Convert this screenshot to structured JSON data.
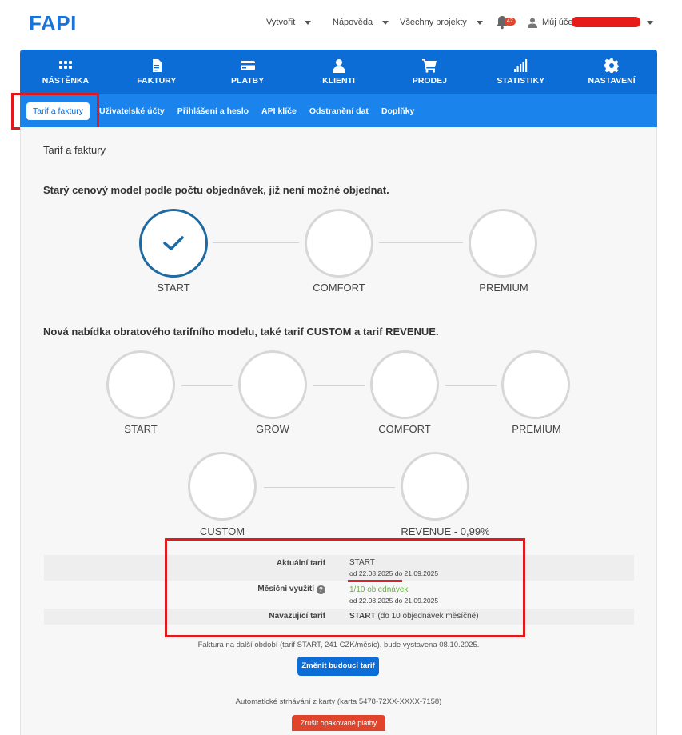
{
  "header": {
    "logo": "FAPI",
    "menu": [
      {
        "label": "Vytvořit"
      },
      {
        "label": "Nápověda"
      },
      {
        "label": "Všechny projekty"
      }
    ],
    "notifications_count": "42",
    "account_label": "Můj účet"
  },
  "main_nav": [
    {
      "label": "NÁSTĚNKA",
      "icon": "dashboard-grid-icon"
    },
    {
      "label": "FAKTURY",
      "icon": "invoice-icon"
    },
    {
      "label": "PLATBY",
      "icon": "credit-card-icon"
    },
    {
      "label": "KLIENTI",
      "icon": "person-icon"
    },
    {
      "label": "PRODEJ",
      "icon": "cart-icon"
    },
    {
      "label": "STATISTIKY",
      "icon": "signal-bars-icon"
    },
    {
      "label": "NASTAVENÍ",
      "icon": "gear-icon"
    }
  ],
  "sub_nav": [
    {
      "label": "Tarif a faktury",
      "active": true
    },
    {
      "label": "Uživatelské účty"
    },
    {
      "label": "Přihlášení a heslo"
    },
    {
      "label": "API klíče"
    },
    {
      "label": "Odstranění dat"
    },
    {
      "label": "Doplňky"
    }
  ],
  "page": {
    "title": "Tarif a faktury",
    "old_model": {
      "heading": "Starý cenový model podle počtu objednávek, již není možné objednat.",
      "steps": [
        "START",
        "COMFORT",
        "PREMIUM"
      ],
      "active_step": "START"
    },
    "new_model": {
      "heading": "Nová nabídka obratového tarifního modelu, také tarif CUSTOM a tarif REVENUE.",
      "steps_row1": [
        "START",
        "GROW",
        "COMFORT",
        "PREMIUM"
      ],
      "steps_row2": [
        "CUSTOM",
        "REVENUE - 0,99%"
      ]
    },
    "tariff_info": {
      "current_label": "Aktuální tarif",
      "current_value": "START",
      "current_period": "od 22.08.2025 do 21.09.2025",
      "usage_label": "Měsíční využití",
      "usage_value": "1/10 objednávek",
      "usage_period": "od 22.08.2025 do 21.09.2025",
      "next_label": "Navazující tarif",
      "next_value_bold": "START",
      "next_value_rest": " (do 10 objednávek měsíčně)"
    },
    "invoice_note": "Faktura na další období (tarif START, 241 CZK/měsíc), bude vystavena 08.10.2025.",
    "change_button": "Změnit budoucí tarif",
    "auto_charge_note": "Automatické strhávání z karty (karta 5478-72XX-XXXX-7158)",
    "cancel_button": "Zrušit opakované platby"
  },
  "colors": {
    "brand_blue": "#0c6dd6",
    "subnav_blue": "#1a84ec",
    "active_circle": "#1f6aa1",
    "annotation_red": "#e0191c",
    "usage_green": "#6ab04c"
  }
}
